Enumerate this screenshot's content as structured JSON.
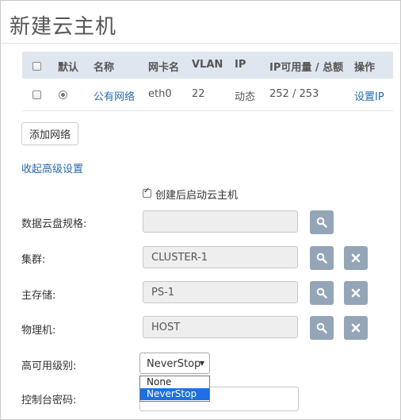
{
  "page": {
    "title": "新建云主机"
  },
  "network_table": {
    "headers": {
      "default": "默认",
      "name": "名称",
      "nic": "网卡名",
      "vlan": "VLAN",
      "ip": "IP",
      "ip_usage": "IP可用量 / 总额",
      "action": "操作"
    },
    "rows": [
      {
        "name": "公有网络",
        "nic": "eth0",
        "vlan": "22",
        "ip": "动态",
        "ip_usage": "252 / 253",
        "action": "设置IP",
        "default_selected": true,
        "checked": false
      }
    ]
  },
  "add_network_label": "添加网络",
  "collapse_advanced_label": "收起高级设置",
  "autostart": {
    "label": "创建后启动云主机",
    "checked": true
  },
  "fields": {
    "data_disk": {
      "label": "数据云盘规格:",
      "value": ""
    },
    "cluster": {
      "label": "集群:",
      "value": "CLUSTER-1"
    },
    "primary_storage": {
      "label": "主存储:",
      "value": "PS-1"
    },
    "host": {
      "label": "物理机:",
      "value": "HOST"
    },
    "ha_level": {
      "label": "高可用级别:",
      "value": "NeverStop",
      "options": [
        "None",
        "NeverStop"
      ]
    },
    "console_password": {
      "label": "控制台密码:",
      "value": ""
    }
  },
  "icons": {
    "search": "search-icon",
    "clear": "close-icon"
  },
  "colors": {
    "accent": "#2a6aa8",
    "icon_button": "#95a5b8",
    "header_bg": "#dfe6ef",
    "selected_option": "#1e70e0"
  }
}
